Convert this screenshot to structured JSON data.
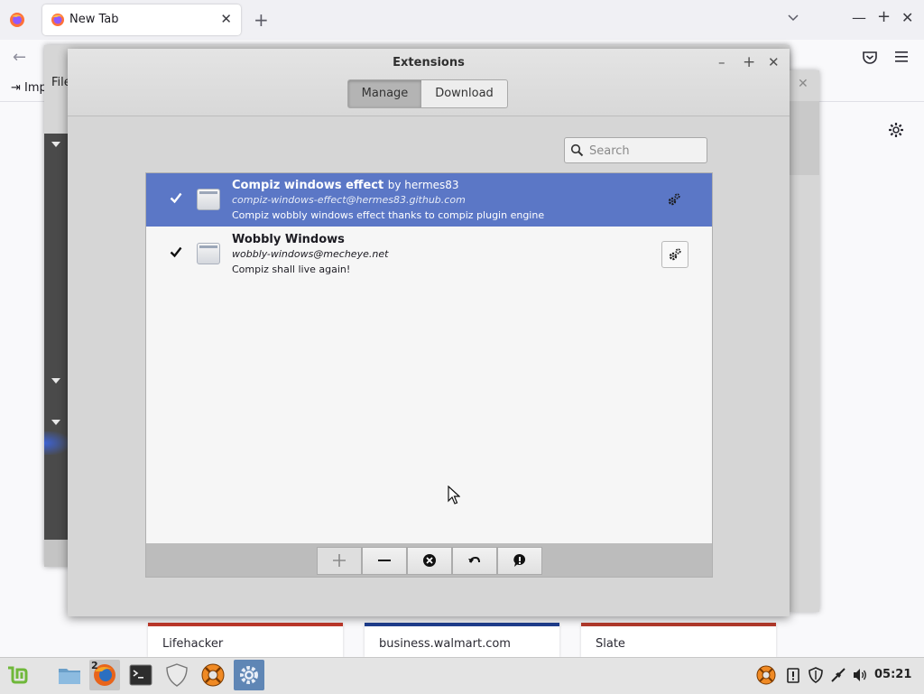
{
  "browser": {
    "tab_title": "New Tab",
    "new_tab_symbol": "+",
    "close_symbol": "✕",
    "minimize_symbol": "—",
    "maximize_symbol": "+",
    "back_symbol": "←",
    "import_label": "Imp",
    "shortcut_tiles": [
      {
        "label": "Lifehacker",
        "color": "#c0392b"
      },
      {
        "label": "business.walmart.com",
        "color": "#1f3f8f"
      },
      {
        "label": "Slate",
        "color": "#b53a2c"
      }
    ]
  },
  "settings_window": {
    "file_label": "File",
    "close_symbol": "✕"
  },
  "dialog": {
    "title": "Extensions",
    "minimize_symbol": "–",
    "maximize_symbol": "+",
    "close_symbol": "✕",
    "tabs": {
      "manage": "Manage",
      "download": "Download",
      "active": "Manage"
    },
    "search": {
      "placeholder": "Search",
      "value": ""
    },
    "extensions": [
      {
        "name": "Compiz windows effect",
        "author": "by hermes83",
        "uuid": "compiz-windows-effect@hermes83.github.com",
        "description": "Compiz wobbly windows effect thanks to compiz plugin engine",
        "enabled": true,
        "selected": true
      },
      {
        "name": "Wobbly Windows",
        "author": "",
        "uuid": "wobbly-windows@mecheye.net",
        "description": "Compiz shall live again!",
        "enabled": true,
        "selected": false
      }
    ],
    "toolbar": [
      "plus-icon",
      "minus-icon",
      "remove-icon",
      "undo-icon",
      "info-icon"
    ]
  },
  "taskbar": {
    "firefox_window_count": "2",
    "clock": "05:21"
  },
  "colors": {
    "selection": "#5b77c6",
    "mint_green": "#6fb83a"
  }
}
